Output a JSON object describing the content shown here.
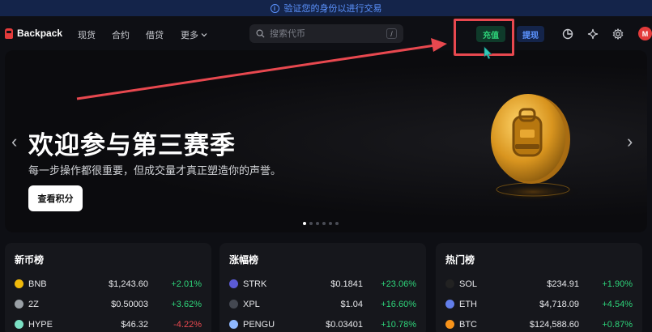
{
  "verify_banner": {
    "text": "验证您的身份以进行交易"
  },
  "brand": {
    "name": "Backpack",
    "color": "#e33b3b"
  },
  "nav": {
    "spot": "现货",
    "futures": "合约",
    "lend": "借贷",
    "more": "更多"
  },
  "search": {
    "placeholder": "搜索代币",
    "shortcut": "/"
  },
  "actions": {
    "deposit": "充值",
    "withdraw": "提现"
  },
  "user": {
    "avatar_letter": "M"
  },
  "hero": {
    "title": "欢迎参与第三赛季",
    "subtitle": "每一步操作都很重要，但成交量才真正塑造你的声誉。",
    "button": "查看积分",
    "active_slide": 1,
    "slide_count": 6
  },
  "cards": [
    {
      "title": "新币榜",
      "rows": [
        {
          "symbol": "BNB",
          "price": "$1,243.60",
          "change": "+2.01%",
          "dir": "up",
          "icon": "bnb-icon",
          "color": "#f0b90b"
        },
        {
          "symbol": "2Z",
          "price": "$0.50003",
          "change": "+3.62%",
          "dir": "up",
          "icon": "2z-icon",
          "color": "#9aa0a6"
        },
        {
          "symbol": "HYPE",
          "price": "$46.32",
          "change": "-4.22%",
          "dir": "down",
          "icon": "hype-icon",
          "color": "#7be0c4"
        }
      ]
    },
    {
      "title": "涨幅榜",
      "rows": [
        {
          "symbol": "STRK",
          "price": "$0.1841",
          "change": "+23.06%",
          "dir": "up",
          "icon": "strk-icon",
          "color": "#5b5bd6"
        },
        {
          "symbol": "XPL",
          "price": "$1.04",
          "change": "+16.60%",
          "dir": "up",
          "icon": "xpl-icon",
          "color": "#444851"
        },
        {
          "symbol": "PENGU",
          "price": "$0.03401",
          "change": "+10.78%",
          "dir": "up",
          "icon": "pengu-icon",
          "color": "#8fb8ff"
        }
      ]
    },
    {
      "title": "热门榜",
      "rows": [
        {
          "symbol": "SOL",
          "price": "$234.91",
          "change": "+1.90%",
          "dir": "up",
          "icon": "sol-icon",
          "color": "#222"
        },
        {
          "symbol": "ETH",
          "price": "$4,718.09",
          "change": "+4.54%",
          "dir": "up",
          "icon": "eth-icon",
          "color": "#627eea"
        },
        {
          "symbol": "BTC",
          "price": "$124,588.60",
          "change": "+0.87%",
          "dir": "up",
          "icon": "btc-icon",
          "color": "#f7931a"
        }
      ]
    }
  ]
}
